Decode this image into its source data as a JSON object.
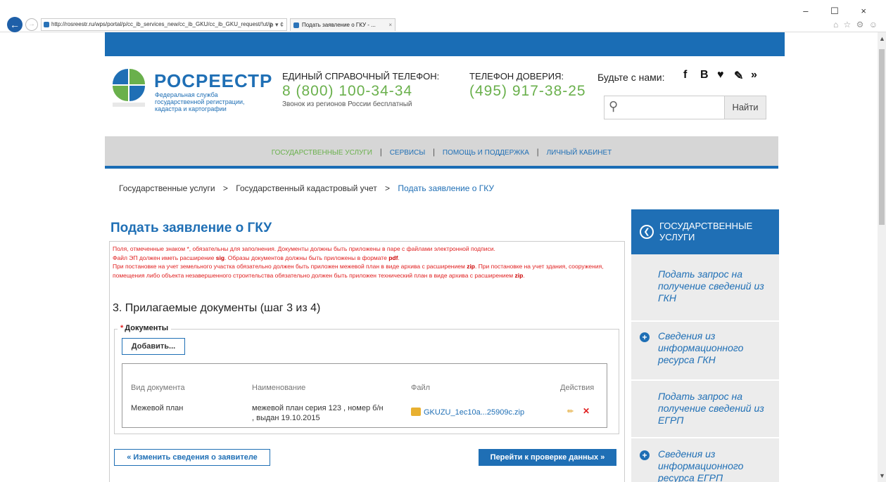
{
  "browser": {
    "url": "http://rosreestr.ru/wps/portal/p/cc_ib_services_new/cc_ib_GKU/cc_ib_GKU_request/!ut/p",
    "url_controls": "ρ ▾ ¢",
    "tab_title": "Подать заявление о ГКУ - ...",
    "tab_close": "×",
    "back": "←",
    "forward": "→",
    "window_controls": "– ☐ ×",
    "toolbar_icons": "⌂ ☆ ⚙ ☺"
  },
  "header": {
    "logo_title": "РОСРЕЕСТР",
    "logo_subtitle": "Федеральная служба государственной регистрации, кадастра и картографии",
    "ref_label": "ЕДИНЫЙ СПРАВОЧНЫЙ ТЕЛЕФОН:",
    "ref_phone": "8 (800) 100-34-34",
    "ref_note": "Звонок из регионов России бесплатный",
    "trust_label": "ТЕЛЕФОН ДОВЕРИЯ:",
    "trust_phone": "(495) 917-38-25",
    "social_label": "Будьте с нами:",
    "social": [
      "f",
      "B",
      "♥",
      "✎",
      "»"
    ],
    "search_placeholder": "",
    "search_button": "Найти",
    "search_icon": "⚲"
  },
  "menu": {
    "items": [
      "ГОСУДАРСТВЕННЫЕ УСЛУГИ",
      "СЕРВИСЫ",
      "ПОМОЩЬ И ПОДДЕРЖКА",
      "ЛИЧНЫЙ КАБИНЕТ"
    ],
    "separator": "|"
  },
  "breadcrumb": {
    "items": [
      "Государственные услуги",
      "Государственный кадастровый учет",
      "Подать заявление о ГКУ"
    ],
    "separator": ">"
  },
  "main": {
    "title": "Подать заявление о ГКУ",
    "notice": {
      "line1": "Поля, отмеченные знаком *, обязательны для заполнения. Документы должны быть приложены в паре с файлами электронной подписи.",
      "line2_pre": "Файл ЭП должен иметь расширение ",
      "line2_sig": "sig",
      "line2_mid": ". Образы документов должны быть приложены в формате ",
      "line2_pdf": "pdf",
      "line2_end": ".",
      "line3_pre": "При постановке на учет земельного участка обязательно должен быть приложен межевой план в виде архива с расширением ",
      "line3_zip": "zip",
      "line3_mid": ". При постановке на учет здания, сооружения, помещения либо объекта незавершенного строительства обязательно должен быть приложен технический план в виде архива с расширением ",
      "line3_zip2": "zip",
      "line3_end": "."
    },
    "step_title": "3. Прилагаемые документы (шаг 3 из 4)",
    "documents_legend": "Документы",
    "required_mark": "*",
    "add_button": "Добавить...",
    "table": {
      "columns": [
        "Вид документа",
        "Наименование",
        "Файл",
        "Действия"
      ],
      "rows": [
        {
          "type": "Межевой план",
          "name": "межевой план серия 123 , номер б/н , выдан 19.10.2015",
          "file": "GKUZU_1ec10a...25909c.zip",
          "edit_icon": "✏",
          "delete_icon": "✕"
        }
      ]
    },
    "back_button": "« Изменить сведения о заявителе",
    "next_button": "Перейти к проверке данных »"
  },
  "sidebar": {
    "header_icon": "❮",
    "header": "ГОСУДАРСТВЕННЫЕ УСЛУГИ",
    "links": [
      {
        "label": "Подать запрос на получение сведений из ГКН",
        "has_plus": false
      },
      {
        "label": "Сведения из информационного ресурса ГКН",
        "has_plus": true
      },
      {
        "label": "Подать запрос на получение сведений из ЕГРП",
        "has_plus": false
      },
      {
        "label": "Сведения из информационного ресурса ЕГРП",
        "has_plus": true
      }
    ],
    "plus_icon": "+"
  },
  "colors": {
    "brand_blue": "#1f6fb5",
    "accent_green": "#6ab04c",
    "notice_red": "#e02020",
    "menu_bg": "#d6d6d6"
  }
}
